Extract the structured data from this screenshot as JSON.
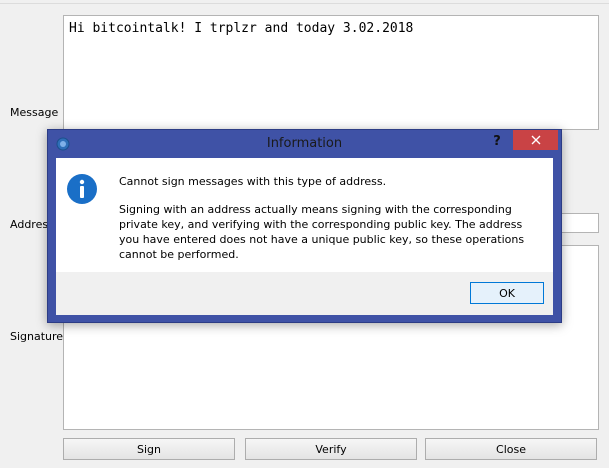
{
  "labels": {
    "message": "Message",
    "address": "Address",
    "signature": "Signature"
  },
  "message_text": "Hi bitcointalk! I trplzr and today 3.02.2018",
  "buttons": {
    "sign": "Sign",
    "verify": "Verify",
    "close": "Close"
  },
  "dialog": {
    "title": "Information",
    "help_glyph": "?",
    "heading": "Cannot sign messages with this type of address.",
    "detail": "Signing with an address actually means signing with the corresponding private key, and verifying with the corresponding public key. The address you have entered does not have a unique public key, so these operations cannot be performed.",
    "ok_label": "OK",
    "icon": "info-icon"
  },
  "colors": {
    "dialog_frame": "#3f52a6",
    "close_button": "#c94345",
    "info_icon": "#1a6fc7",
    "ok_border": "#0078d7"
  }
}
